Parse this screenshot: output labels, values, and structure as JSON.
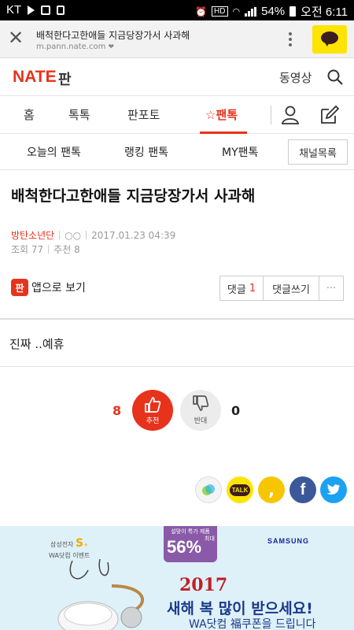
{
  "status_bar": {
    "carrier": "KT",
    "battery": "54%",
    "time": "오전 6:11"
  },
  "browser": {
    "page_title": "배척한다고한애들 지금당장가서 사과해",
    "url": "m.pann.nate.com"
  },
  "header": {
    "logo": "NATE",
    "section": "판",
    "video_link": "동영상"
  },
  "nav": {
    "items": [
      "홈",
      "톡톡",
      "판포토",
      "팬톡"
    ]
  },
  "subnav": {
    "items": [
      "오늘의 팬톡",
      "랭킹 팬톡",
      "MY팬톡"
    ],
    "channel_button": "채널목록"
  },
  "article": {
    "title": "배척한다고한애들 지금당장가서 사과해",
    "author": "방탄소년단",
    "nickname": "○○",
    "date": "2017.01.23 04:39",
    "views_label": "조회",
    "views": "77",
    "recommend_label": "추천",
    "recommend": "8",
    "body": "진짜 ..예휴"
  },
  "actions": {
    "app_icon_text": "판",
    "app_view": "앱으로 보기",
    "comment_label": "댓글",
    "comment_count": "1",
    "write_comment": "댓글쓰기",
    "more": "···"
  },
  "votes": {
    "up_count": "8",
    "up_label": "추천",
    "down_count": "0",
    "down_label": "반대"
  },
  "share": {
    "talk_label": "TALK",
    "facebook": "f"
  },
  "ad": {
    "brand": "SAMSUNG",
    "badge_top": "설맞이 특가 제품",
    "badge_percent": "56%",
    "badge_max": "최대",
    "year": "2017",
    "headline": "새해 복 많이 받으세요!",
    "subline": "WA닷컴 福쿠폰을 드립니다",
    "left_top": "삼성전자",
    "left_mid": "WA닷컴 이벤트"
  },
  "colors": {
    "accent": "#e8331c",
    "kakao": "#ffe400",
    "facebook": "#3b5998",
    "twitter": "#1da1f2"
  }
}
